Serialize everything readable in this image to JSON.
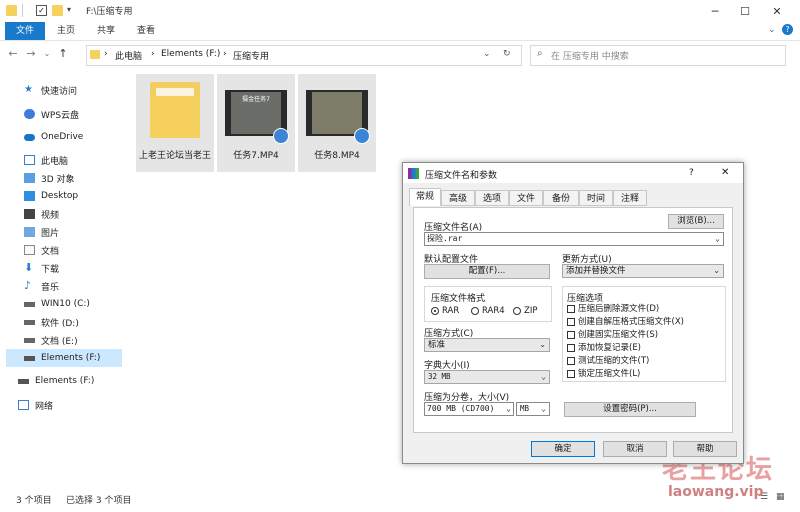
{
  "window": {
    "title": "F:\\压缩专用"
  },
  "ribbon": {
    "tabs": [
      "文件",
      "主页",
      "共享",
      "查看"
    ]
  },
  "address": {
    "crumbs": [
      "此电脑",
      "Elements (F:)",
      "压缩专用"
    ],
    "search_placeholder": "在 压缩专用 中搜索"
  },
  "sidebar": {
    "items": [
      {
        "label": "快速访问",
        "icon": "star-icon"
      },
      {
        "label": "WPS云盘",
        "icon": "cloud-icon"
      },
      {
        "label": "OneDrive",
        "icon": "onedrive-icon"
      },
      {
        "label": "此电脑",
        "icon": "computer-icon"
      },
      {
        "label": "3D 对象",
        "icon": "cube-icon"
      },
      {
        "label": "Desktop",
        "icon": "desktop-icon"
      },
      {
        "label": "视频",
        "icon": "video-icon"
      },
      {
        "label": "图片",
        "icon": "picture-icon"
      },
      {
        "label": "文档",
        "icon": "document-icon"
      },
      {
        "label": "下载",
        "icon": "download-icon"
      },
      {
        "label": "音乐",
        "icon": "music-icon"
      },
      {
        "label": "WIN10 (C:)",
        "icon": "drive-icon"
      },
      {
        "label": "软件 (D:)",
        "icon": "drive-icon"
      },
      {
        "label": "文档 (E:)",
        "icon": "drive-icon"
      },
      {
        "label": "Elements (F:)",
        "icon": "drive-icon"
      },
      {
        "label": "Elements (F:)",
        "icon": "drive-icon"
      },
      {
        "label": "网络",
        "icon": "network-icon"
      }
    ]
  },
  "files": [
    {
      "name": "上老王论坛当老王",
      "type": "folder"
    },
    {
      "name": "任务7.MP4",
      "type": "video",
      "thumb_caption": "摄金任务7"
    },
    {
      "name": "任务8.MP4",
      "type": "video"
    }
  ],
  "status": {
    "count": "3 个项目",
    "selected": "已选择 3 个项目"
  },
  "dialog": {
    "title": "压缩文件名和参数",
    "help_symbol": "?",
    "tabs": [
      "常规",
      "高级",
      "选项",
      "文件",
      "备份",
      "时间",
      "注释"
    ],
    "archive_name_label": "压缩文件名(A)",
    "browse_button": "浏览(B)...",
    "archive_name_value": "探险.rar",
    "default_profile_label": "默认配置文件",
    "profile_button": "配置(F)...",
    "update_mode_label": "更新方式(U)",
    "update_mode_value": "添加并替换文件",
    "format_label": "压缩文件格式",
    "formats": [
      "RAR",
      "RAR4",
      "ZIP"
    ],
    "format_selected": "RAR",
    "method_label": "压缩方式(C)",
    "method_value": "标准",
    "dict_label": "字典大小(I)",
    "dict_value": "32 MB",
    "split_label": "压缩为分卷，大小(V)",
    "split_value": "700 MB  (CD700)",
    "split_unit": "MB",
    "password_button": "设置密码(P)...",
    "options_label": "压缩选项",
    "options": [
      {
        "label": "压缩后删除源文件(D)",
        "checked": false
      },
      {
        "label": "创建自解压格式压缩文件(X)",
        "checked": false
      },
      {
        "label": "创建固实压缩文件(S)",
        "checked": false
      },
      {
        "label": "添加恢复记录(E)",
        "checked": false
      },
      {
        "label": "测试压缩的文件(T)",
        "checked": false
      },
      {
        "label": "锁定压缩文件(L)",
        "checked": false
      }
    ],
    "ok_button": "确定",
    "cancel_button": "取消",
    "help_button": "帮助"
  },
  "watermark": {
    "line1": "老王论坛",
    "line2": "laowang.vip"
  },
  "colors": {
    "accent": "#1979ca",
    "selection": "#cce8ff",
    "folder": "#f6d15e"
  }
}
